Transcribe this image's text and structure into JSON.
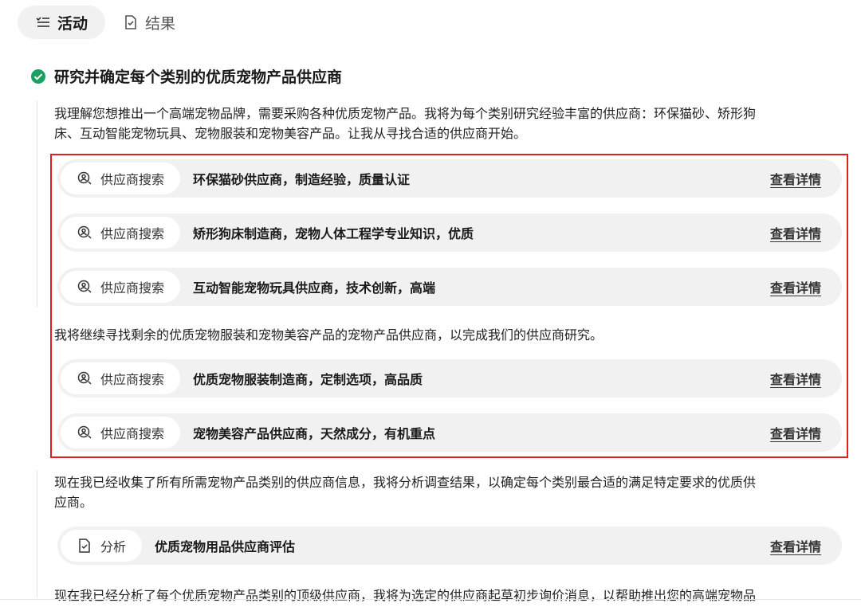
{
  "tabs": [
    {
      "label": "活动",
      "icon": "list-icon",
      "active": true
    },
    {
      "label": "结果",
      "icon": "document-result-icon",
      "active": false
    }
  ],
  "task": {
    "status_icon": "check-circle-icon",
    "status_color": "#19a15f",
    "title": "研究并确定每个类别的优质宠物产品供应商"
  },
  "paragraphs": {
    "intro_line1": "我理解您想推出一个高端宠物品牌，需要采购各种优质宠物产品。我将为每个类别研究经验丰富的供应商：环保猫砂、矫形狗",
    "intro_line2": "床、互动智能宠物玩具、宠物服装和宠物美容产品。让我从寻找合适的供应商开始。",
    "continue": "我将继续寻找剩余的优质宠物服装和宠物美容产品的宠物产品供应商，以完成我们的供应商研究。",
    "collected_line1": "现在我已经收集了所有所需宠物产品类别的供应商信息，我将分析调查结果，以确定每个类别最合适的满足特定要求的优质供",
    "collected_line2": "应商。",
    "analyzed": "现在我已经分析了每个优质宠物产品类别的顶级供应商，我将为选定的供应商起草初步询价消息，以帮助推出您的高端宠物品"
  },
  "tool_calls": [
    {
      "tool_label": "供应商搜索",
      "icon": "supplier-search-icon",
      "query": "环保猫砂供应商，制造经验，质量认证",
      "link": "查看详情"
    },
    {
      "tool_label": "供应商搜索",
      "icon": "supplier-search-icon",
      "query": "矫形狗床制造商，宠物人体工程学专业知识，优质",
      "link": "查看详情"
    },
    {
      "tool_label": "供应商搜索",
      "icon": "supplier-search-icon",
      "query": "互动智能宠物玩具供应商，技术创新，高端",
      "link": "查看详情"
    },
    {
      "tool_label": "供应商搜索",
      "icon": "supplier-search-icon",
      "query": "优质宠物服装制造商，定制选项，高品质",
      "link": "查看详情"
    },
    {
      "tool_label": "供应商搜索",
      "icon": "supplier-search-icon",
      "query": "宠物美容产品供应商，天然成分，有机重点",
      "link": "查看详情"
    },
    {
      "tool_label": "分析",
      "icon": "analysis-document-icon",
      "query": "优质宠物用品供应商评估",
      "link": "查看详情"
    }
  ],
  "highlight_color": "#e02020"
}
